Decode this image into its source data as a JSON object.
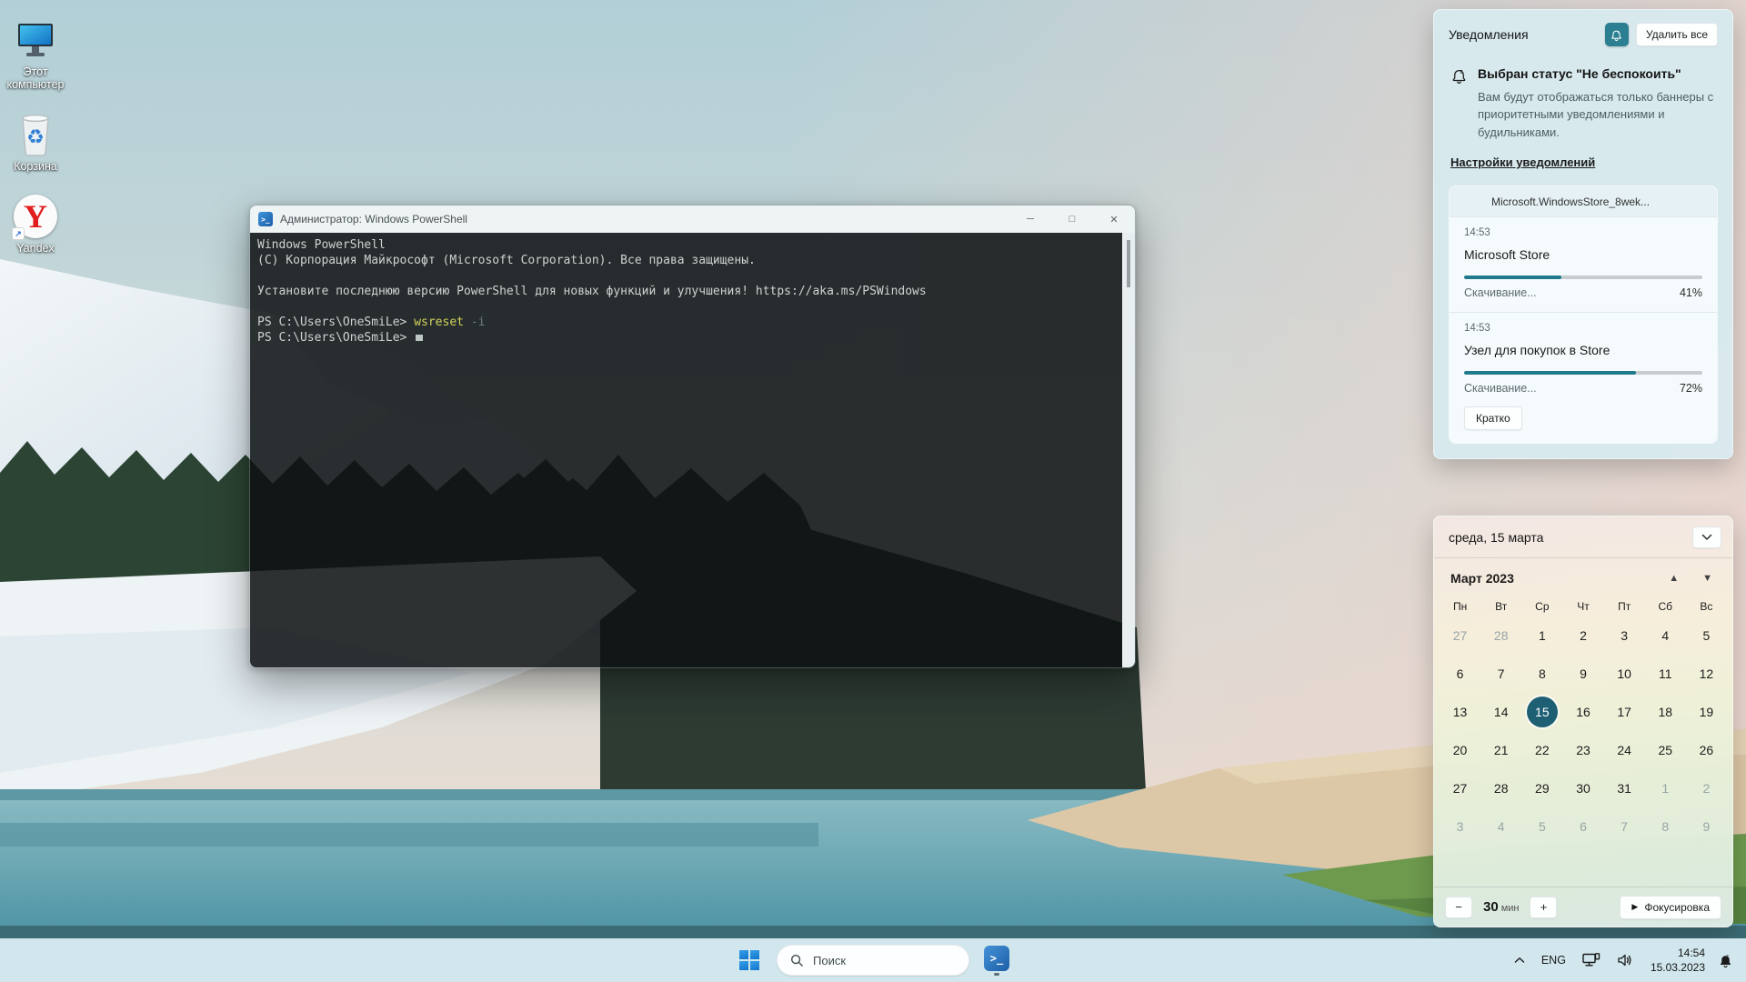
{
  "desktop": {
    "icons": [
      {
        "label": "Этот компьютер",
        "kind": "this-pc"
      },
      {
        "label": "Корзина",
        "kind": "recycle-bin"
      },
      {
        "label": "Yandex",
        "kind": "yandex"
      }
    ]
  },
  "powershell": {
    "title": "Администратор: Windows PowerShell",
    "window_controls": {
      "minimize": "─",
      "maximize": "□",
      "close": "✕"
    },
    "lines": [
      [
        {
          "t": "Windows PowerShell"
        }
      ],
      [
        {
          "t": "(C) Корпорация Майкрософт (Microsoft Corporation). Все права защищены."
        }
      ],
      [],
      [
        {
          "t": "Установите последнюю версию PowerShell для новых функций и улучшения! https://aka.ms/PSWindows"
        }
      ],
      [],
      [
        {
          "t": "PS C:\\Users\\OneSmiLe> "
        },
        {
          "t": "wsreset",
          "c": "cmd"
        },
        {
          "t": " "
        },
        {
          "t": "-i",
          "c": "param"
        }
      ],
      [
        {
          "t": "PS C:\\Users\\OneSmiLe> "
        },
        {
          "t": "",
          "c": "cursor"
        }
      ]
    ]
  },
  "notifications": {
    "title": "Уведомления",
    "clear_all_label": "Удалить все",
    "dnd_icon": "bell-snooze-icon",
    "dnd_title": "Выбран статус \"Не беспокоить\"",
    "dnd_body": "Вам будут отображаться только баннеры с приоритетными уведомлениями и будильниками.",
    "settings_link": "Настройки уведомлений",
    "group_title": "Microsoft.WindowsStore_8wek...",
    "cards": [
      {
        "time": "14:53",
        "title": "Microsoft Store",
        "status": "Скачивание...",
        "percent_label": "41%",
        "progress": 41
      },
      {
        "time": "14:53",
        "title": "Узел для покупок в Store",
        "status": "Скачивание...",
        "percent_label": "72%",
        "progress": 72,
        "action": "Кратко"
      }
    ],
    "accent_color": "#1e7a8c"
  },
  "calendar": {
    "date_header": "среда, 15 марта",
    "month_label": "Март 2023",
    "weekdays": [
      "Пн",
      "Вт",
      "Ср",
      "Чт",
      "Пт",
      "Сб",
      "Вс"
    ],
    "weeks": [
      [
        {
          "d": "27",
          "cls": "out"
        },
        {
          "d": "28",
          "cls": "out"
        },
        {
          "d": "1"
        },
        {
          "d": "2"
        },
        {
          "d": "3"
        },
        {
          "d": "4"
        },
        {
          "d": "5"
        }
      ],
      [
        {
          "d": "6"
        },
        {
          "d": "7"
        },
        {
          "d": "8"
        },
        {
          "d": "9"
        },
        {
          "d": "10"
        },
        {
          "d": "11"
        },
        {
          "d": "12"
        }
      ],
      [
        {
          "d": "13"
        },
        {
          "d": "14"
        },
        {
          "d": "15",
          "cls": "sel"
        },
        {
          "d": "16"
        },
        {
          "d": "17"
        },
        {
          "d": "18"
        },
        {
          "d": "19"
        }
      ],
      [
        {
          "d": "20"
        },
        {
          "d": "21"
        },
        {
          "d": "22"
        },
        {
          "d": "23"
        },
        {
          "d": "24"
        },
        {
          "d": "25"
        },
        {
          "d": "26"
        }
      ],
      [
        {
          "d": "27"
        },
        {
          "d": "28"
        },
        {
          "d": "29"
        },
        {
          "d": "30"
        },
        {
          "d": "31"
        },
        {
          "d": "1",
          "cls": "out"
        },
        {
          "d": "2",
          "cls": "out"
        }
      ],
      [
        {
          "d": "3",
          "cls": "out"
        },
        {
          "d": "4",
          "cls": "out"
        },
        {
          "d": "5",
          "cls": "out"
        },
        {
          "d": "6",
          "cls": "out"
        },
        {
          "d": "7",
          "cls": "out"
        },
        {
          "d": "8",
          "cls": "out"
        },
        {
          "d": "9",
          "cls": "out"
        }
      ]
    ],
    "selected_day": "15",
    "focus_timer": {
      "minus": "−",
      "value": "30",
      "unit": "мин",
      "plus": "+",
      "play": "▶",
      "button_label": "Фокусировка"
    }
  },
  "taskbar": {
    "search_placeholder": "Поиск",
    "tray": {
      "lang": "ENG",
      "time": "14:54",
      "date": "15.03.2023"
    }
  }
}
